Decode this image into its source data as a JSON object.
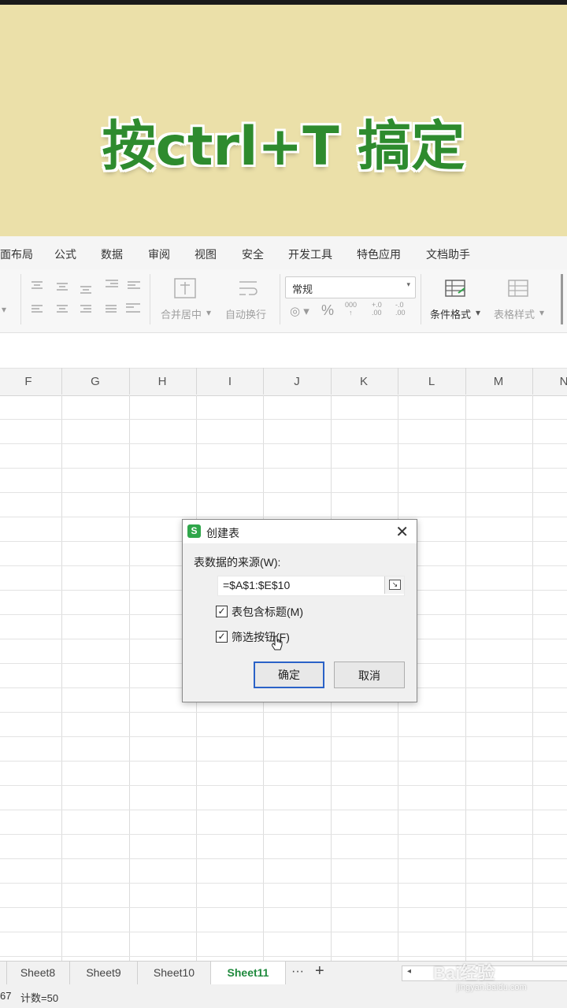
{
  "banner": {
    "title": "按ctrl+T 搞定"
  },
  "menu": {
    "items": [
      "面布局",
      "公式",
      "数据",
      "审阅",
      "视图",
      "安全",
      "开发工具",
      "特色应用",
      "文档助手"
    ]
  },
  "ribbon": {
    "merge_center": "合并居中",
    "wrap_text": "自动换行",
    "number_format": "常规",
    "conditional_format": "条件格式",
    "table_style": "表格样式"
  },
  "columns": [
    "F",
    "G",
    "H",
    "I",
    "J",
    "K",
    "L",
    "M",
    "N"
  ],
  "dialog": {
    "title": "创建表",
    "source_label": "表数据的来源(W):",
    "range_value": "=$A$1:$E$10",
    "has_headers_label": "表包含标题(M)",
    "has_headers_checked": true,
    "filter_button_label": "筛选按钮(F)",
    "filter_button_checked": true,
    "ok_label": "确定",
    "cancel_label": "取消"
  },
  "sheets": [
    "Sheet8",
    "Sheet9",
    "Sheet10",
    "Sheet11"
  ],
  "active_sheet": "Sheet11",
  "tab_more": "···",
  "tab_add": "+",
  "status": {
    "left": "67",
    "count": "计数=50"
  },
  "watermark": {
    "brand": "Bai经验",
    "url": "jingyan.baidu.com"
  },
  "colors": {
    "accent": "#1f8a3d",
    "banner_bg": "#ebe0a9",
    "banner_text": "#2e8b2e",
    "primary_button_border": "#2a62c7"
  }
}
